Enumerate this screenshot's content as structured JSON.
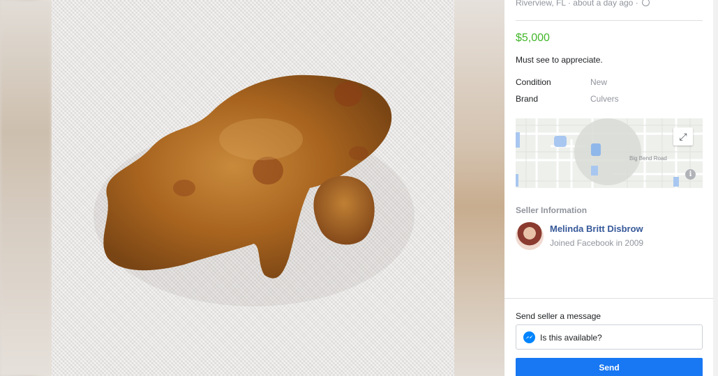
{
  "listing": {
    "location": "Riverview, FL",
    "separator": "·",
    "posted": "about a day ago",
    "price": "$5,000",
    "description": "Must see to appreciate.",
    "details": [
      {
        "key": "Condition",
        "value": "New"
      },
      {
        "key": "Brand",
        "value": "Culvers"
      }
    ]
  },
  "map": {
    "road_label": "Big Bend Road",
    "expand_icon": "expand-arrows-icon",
    "info_icon": "info-icon"
  },
  "seller": {
    "heading": "Seller Information",
    "name": "Melinda Britt Disbrow",
    "joined": "Joined Facebook in 2009"
  },
  "message": {
    "title": "Send seller a message",
    "input_value": "Is this available?",
    "send_label": "Send"
  },
  "colors": {
    "price": "#42b72a",
    "link": "#365899",
    "send_button": "#1877f2",
    "muted": "#90949c"
  }
}
